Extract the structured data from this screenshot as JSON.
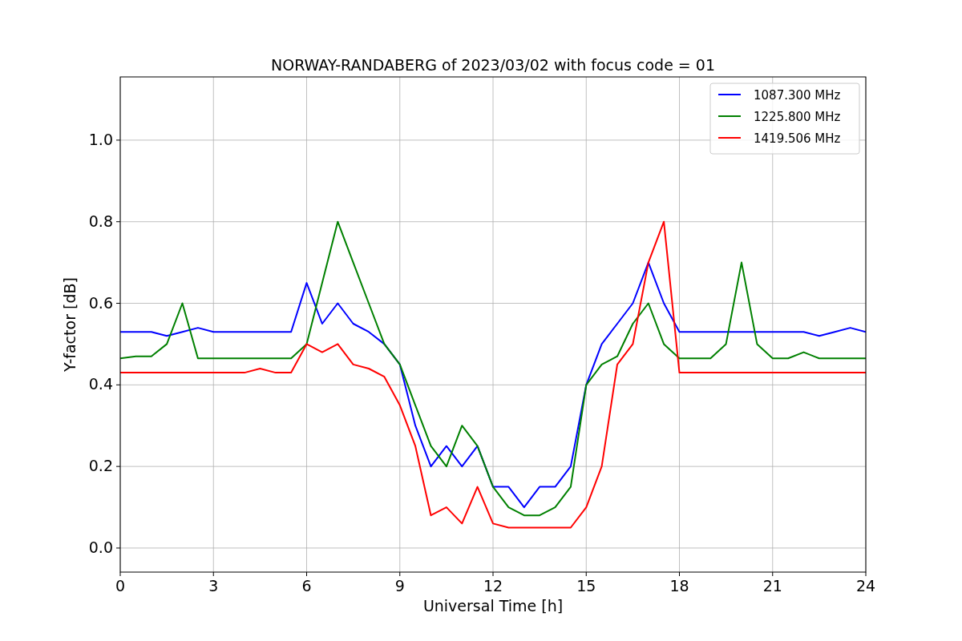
{
  "figure": {
    "chart_data": {
      "type": "line",
      "title": "NORWAY-RANDABERG of 2023/03/02 with focus code = 01",
      "xlabel": "Universal Time [h]",
      "ylabel": "Y-factor [dB]",
      "x": [
        0,
        0.5,
        1,
        1.5,
        2,
        2.5,
        3,
        3.5,
        4,
        4.5,
        5,
        5.5,
        6,
        6.5,
        7,
        7.5,
        8,
        8.5,
        9,
        9.5,
        10,
        10.5,
        11,
        11.5,
        12,
        12.5,
        13,
        13.5,
        14,
        14.5,
        15,
        15.5,
        16,
        16.5,
        17,
        17.5,
        18,
        18.5,
        19,
        19.5,
        20,
        20.5,
        21,
        21.5,
        22,
        22.5,
        23,
        23.5,
        24
      ],
      "series": [
        {
          "name": "1087.300 MHz",
          "color": "#0000ff",
          "values": [
            0.53,
            0.53,
            0.53,
            0.52,
            0.53,
            0.54,
            0.53,
            0.53,
            0.53,
            0.53,
            0.53,
            0.53,
            0.65,
            0.55,
            0.6,
            0.55,
            0.53,
            0.5,
            0.45,
            0.3,
            0.2,
            0.25,
            0.2,
            0.25,
            0.15,
            0.15,
            0.1,
            0.15,
            0.15,
            0.2,
            0.4,
            0.5,
            0.55,
            0.6,
            0.7,
            0.6,
            0.53,
            0.53,
            0.53,
            0.53,
            0.53,
            0.53,
            0.53,
            0.53,
            0.53,
            0.52,
            0.53,
            0.54,
            0.53
          ]
        },
        {
          "name": "1225.800 MHz",
          "color": "#008000",
          "values": [
            0.465,
            0.47,
            0.47,
            0.5,
            0.6,
            0.465,
            0.465,
            0.465,
            0.465,
            0.465,
            0.465,
            0.465,
            0.5,
            0.65,
            0.8,
            0.7,
            0.6,
            0.5,
            0.45,
            0.35,
            0.25,
            0.2,
            0.3,
            0.25,
            0.15,
            0.1,
            0.08,
            0.08,
            0.1,
            0.15,
            0.4,
            0.45,
            0.47,
            0.55,
            0.6,
            0.5,
            0.465,
            0.465,
            0.465,
            0.5,
            0.7,
            0.5,
            0.465,
            0.465,
            0.48,
            0.465,
            0.465,
            0.465,
            0.465
          ]
        },
        {
          "name": "1419.506 MHz",
          "color": "#ff0000",
          "values": [
            0.43,
            0.43,
            0.43,
            0.43,
            0.43,
            0.43,
            0.43,
            0.43,
            0.43,
            0.44,
            0.43,
            0.43,
            0.5,
            0.48,
            0.5,
            0.45,
            0.44,
            0.42,
            0.35,
            0.25,
            0.08,
            0.1,
            0.06,
            0.15,
            0.06,
            0.05,
            0.05,
            0.05,
            0.05,
            0.05,
            0.1,
            0.2,
            0.45,
            0.5,
            0.7,
            0.8,
            0.43,
            0.43,
            0.43,
            0.43,
            0.43,
            0.43,
            0.43,
            0.43,
            0.43,
            0.43,
            0.43,
            0.43,
            0.43
          ]
        }
      ],
      "grid": true,
      "legend": true,
      "xlim": [
        0,
        24
      ],
      "ylim": [
        -0.059,
        1.155
      ],
      "xticks": [
        0,
        3,
        6,
        9,
        12,
        15,
        18,
        21,
        24
      ],
      "yticks": [
        {
          "value": 0,
          "label": "0.0"
        },
        {
          "value": 0.2,
          "label": "0.2"
        },
        {
          "value": 0.4,
          "label": "0.4"
        },
        {
          "value": 0.6,
          "label": "0.6"
        },
        {
          "value": 0.8,
          "label": "0.8"
        },
        {
          "value": 1,
          "label": "1.0"
        }
      ]
    }
  }
}
